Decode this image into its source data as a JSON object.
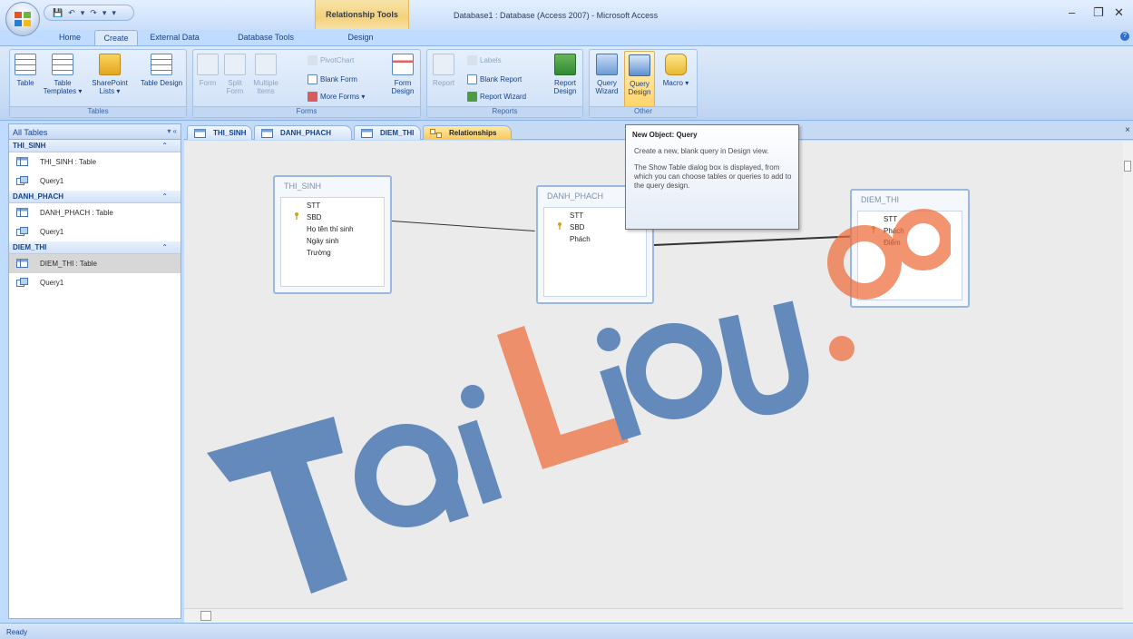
{
  "window": {
    "app_title": "Database1 : Database (Access 2007) - Microsoft Access",
    "context_tools": "Relationship Tools",
    "controls": [
      "–",
      "❐",
      "✕"
    ],
    "qat_glyphs": [
      "💾",
      "↶",
      "▾",
      "↷",
      "▾",
      "▾"
    ]
  },
  "ribbon_tabs": [
    "Home",
    "Create",
    "External Data",
    "Database Tools",
    "Design"
  ],
  "ribbon": {
    "tables": {
      "label": "Tables",
      "table": "Table",
      "table_templates": "Table Templates ▾",
      "sharepoint": "SharePoint Lists ▾",
      "table_design": "Table Design"
    },
    "forms": {
      "label": "Forms",
      "form": "Form",
      "split_form": "Split Form",
      "multiple_items": "Multiple Items",
      "pivotchart": "PivotChart",
      "blank_form": "Blank Form",
      "more_forms": "More Forms ▾",
      "form_design": "Form Design"
    },
    "reports": {
      "label": "Reports",
      "report": "Report",
      "labels": "Labels",
      "blank_report": "Blank Report",
      "report_wizard": "Report Wizard",
      "report_design": "Report Design"
    },
    "other": {
      "label": "Other",
      "query_wizard": "Query Wizard",
      "query_design": "Query Design",
      "macro": "Macro ▾"
    }
  },
  "nav": {
    "header": "All Tables",
    "controls": "▾ «",
    "groups": [
      {
        "name": "THI_SINH",
        "arrow": "⌃",
        "items": [
          "THI_SINH : Table",
          "Query1"
        ]
      },
      {
        "name": "DANH_PHACH",
        "arrow": "⌃",
        "items": [
          "DANH_PHACH : Table",
          "Query1"
        ]
      },
      {
        "name": "DIEM_THI",
        "arrow": "⌃",
        "items": [
          "DIEM_THI : Table",
          "Query1"
        ]
      }
    ]
  },
  "doc_tabs": [
    "THI_SINH",
    "DANH_PHACH",
    "DIEM_THI",
    "Relationships"
  ],
  "doc_close": "×",
  "tables": [
    {
      "name": "THI_SINH",
      "fields": [
        "STT",
        "SBD",
        "Họ tên thí sinh",
        "Ngày sinh",
        "Trường"
      ]
    },
    {
      "name": "DANH_PHACH",
      "fields": [
        "STT",
        "SBD",
        "Phách"
      ]
    },
    {
      "name": "DIEM_THI",
      "fields": [
        "STT",
        "Phách",
        "Điểm"
      ]
    }
  ],
  "tooltip": {
    "title": "New Object: Query",
    "p1": "Create a new, blank query in Design view.",
    "p2": "The Show Table dialog box is displayed, from which you can choose tables or queries to add to the query design."
  },
  "status": "Ready",
  "watermark": "TaiLieu.com",
  "colors": {
    "accent": "#15428b",
    "ribbon": "#c8dcf6",
    "watermark_blue": "#2f62a7",
    "watermark_orange": "#ef6a3a"
  }
}
